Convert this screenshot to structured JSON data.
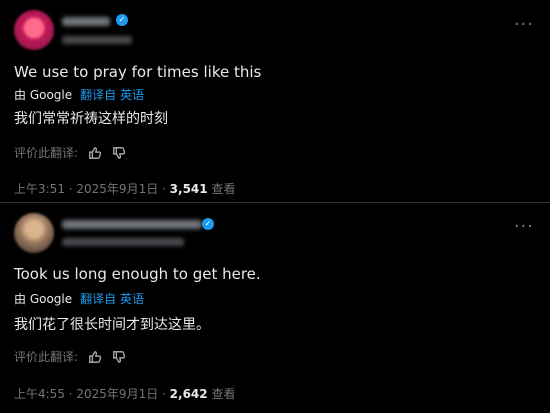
{
  "post1": {
    "verified_glyph": "✓",
    "more_glyph": "···",
    "text": "We use to pray for times like this",
    "translated_by": "由 Google",
    "translated_from": "翻译自 英语",
    "translation": "我们常常祈祷这样的时刻",
    "rate_label": "评价此翻译:",
    "time": "上午3:51 · 2025年9月1日 ·",
    "views": "3,541",
    "views_label": "查看"
  },
  "post2": {
    "verified_glyph": "✓",
    "more_glyph": "···",
    "text": "Took us long enough to get here.",
    "translated_by": "由 Google",
    "translated_from": "翻译自 英语",
    "translation": "我们花了很长时间才到达这里。",
    "rate_label": "评价此翻译:",
    "time": "上午4:55 · 2025年9月1日 ·",
    "views": "2,642",
    "views_label": "查看"
  },
  "colors": {
    "background": "#000000",
    "text": "#e7e9ea",
    "muted": "#71767b",
    "accent": "#1d9bf0"
  },
  "icons": [
    "verified-badge-icon",
    "more-options-icon",
    "thumbs-up-icon",
    "thumbs-down-icon"
  ]
}
